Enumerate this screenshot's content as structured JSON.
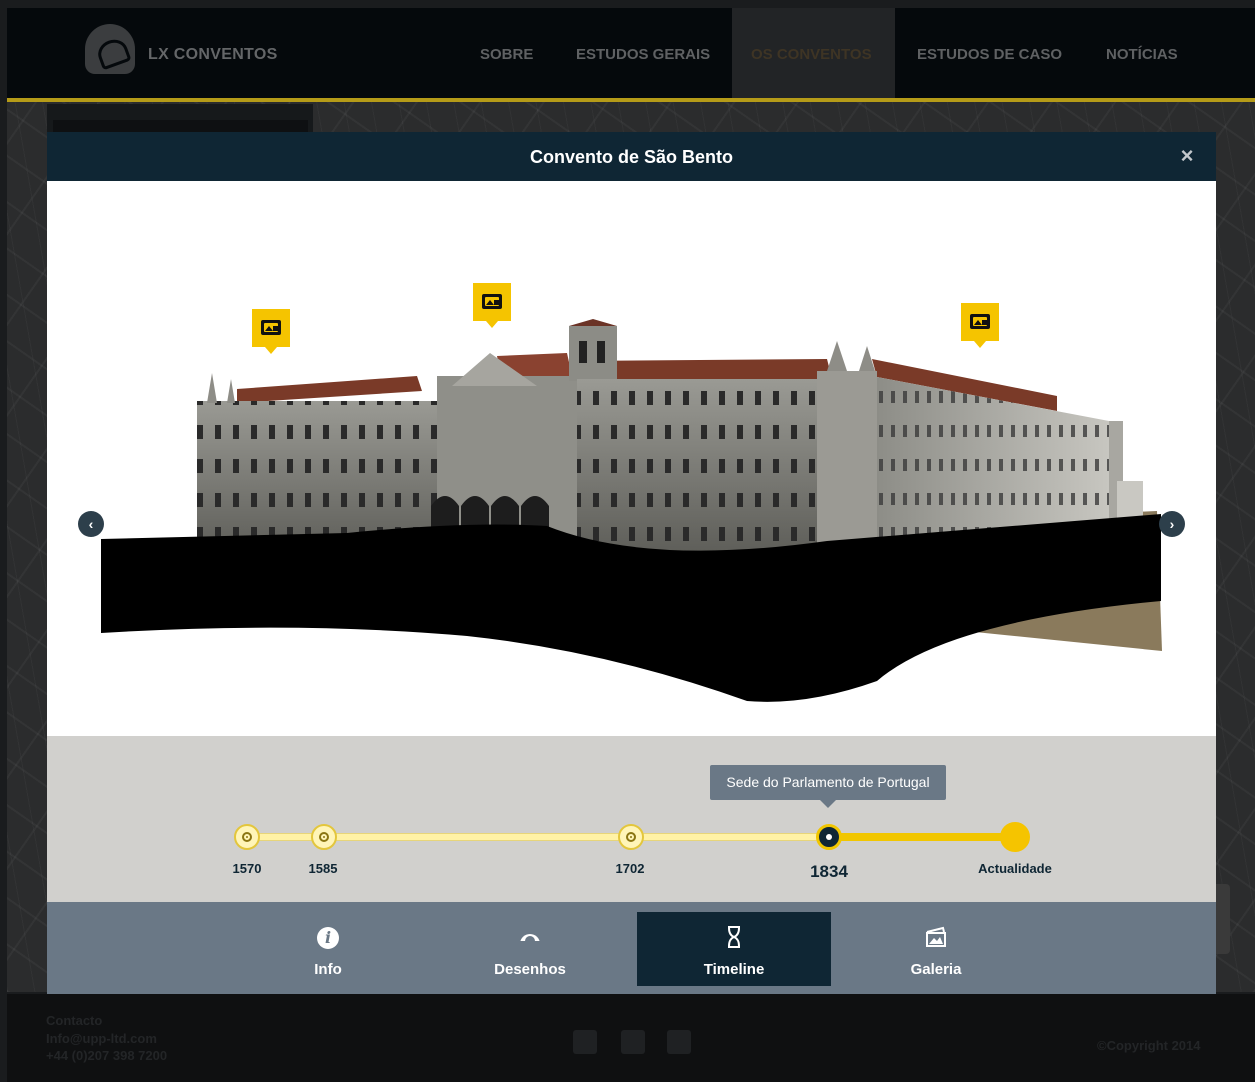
{
  "site": {
    "logo_text": "LX CONVENTOS",
    "nav": [
      {
        "label": "SOBRE"
      },
      {
        "label": "ESTUDOS GERAIS"
      },
      {
        "label": "OS CONVENTOS"
      },
      {
        "label": "ESTUDOS DE CASO"
      },
      {
        "label": "NOTÍCIAS"
      }
    ],
    "active_nav": "OS CONVENTOS"
  },
  "footer": {
    "contact_title": "Contacto",
    "email": "Info@upp-ltd.com",
    "phone": "+44 (0)207 398 7200",
    "copyright": "©Copyright 2014",
    "social_icons": [
      "facebook-icon",
      "twitter-icon",
      "google-plus-icon"
    ]
  },
  "modal": {
    "title": "Convento de São Bento",
    "close_glyph": "×",
    "prev_glyph": "‹",
    "next_glyph": "›",
    "image_pins": [
      "image-icon",
      "image-icon",
      "image-icon"
    ],
    "timeline": {
      "tooltip": "Sede do Parlamento de Portugal",
      "points": [
        {
          "label": "1570"
        },
        {
          "label": "1585"
        },
        {
          "label": "1702"
        },
        {
          "label": "1834"
        },
        {
          "label": "Actualidade"
        }
      ],
      "active": "1834"
    },
    "tabs": [
      {
        "label": "Info",
        "icon": "info-icon"
      },
      {
        "label": "Desenhos",
        "icon": "protractor-icon"
      },
      {
        "label": "Timeline",
        "icon": "hourglass-icon"
      },
      {
        "label": "Galeria",
        "icon": "gallery-icon"
      }
    ],
    "active_tab": "Timeline"
  },
  "colors": {
    "navy": "#0f2634",
    "accent_yellow": "#f5c400",
    "tab_bar": "#6a7886",
    "timeline_bg": "#d1d0cd"
  }
}
